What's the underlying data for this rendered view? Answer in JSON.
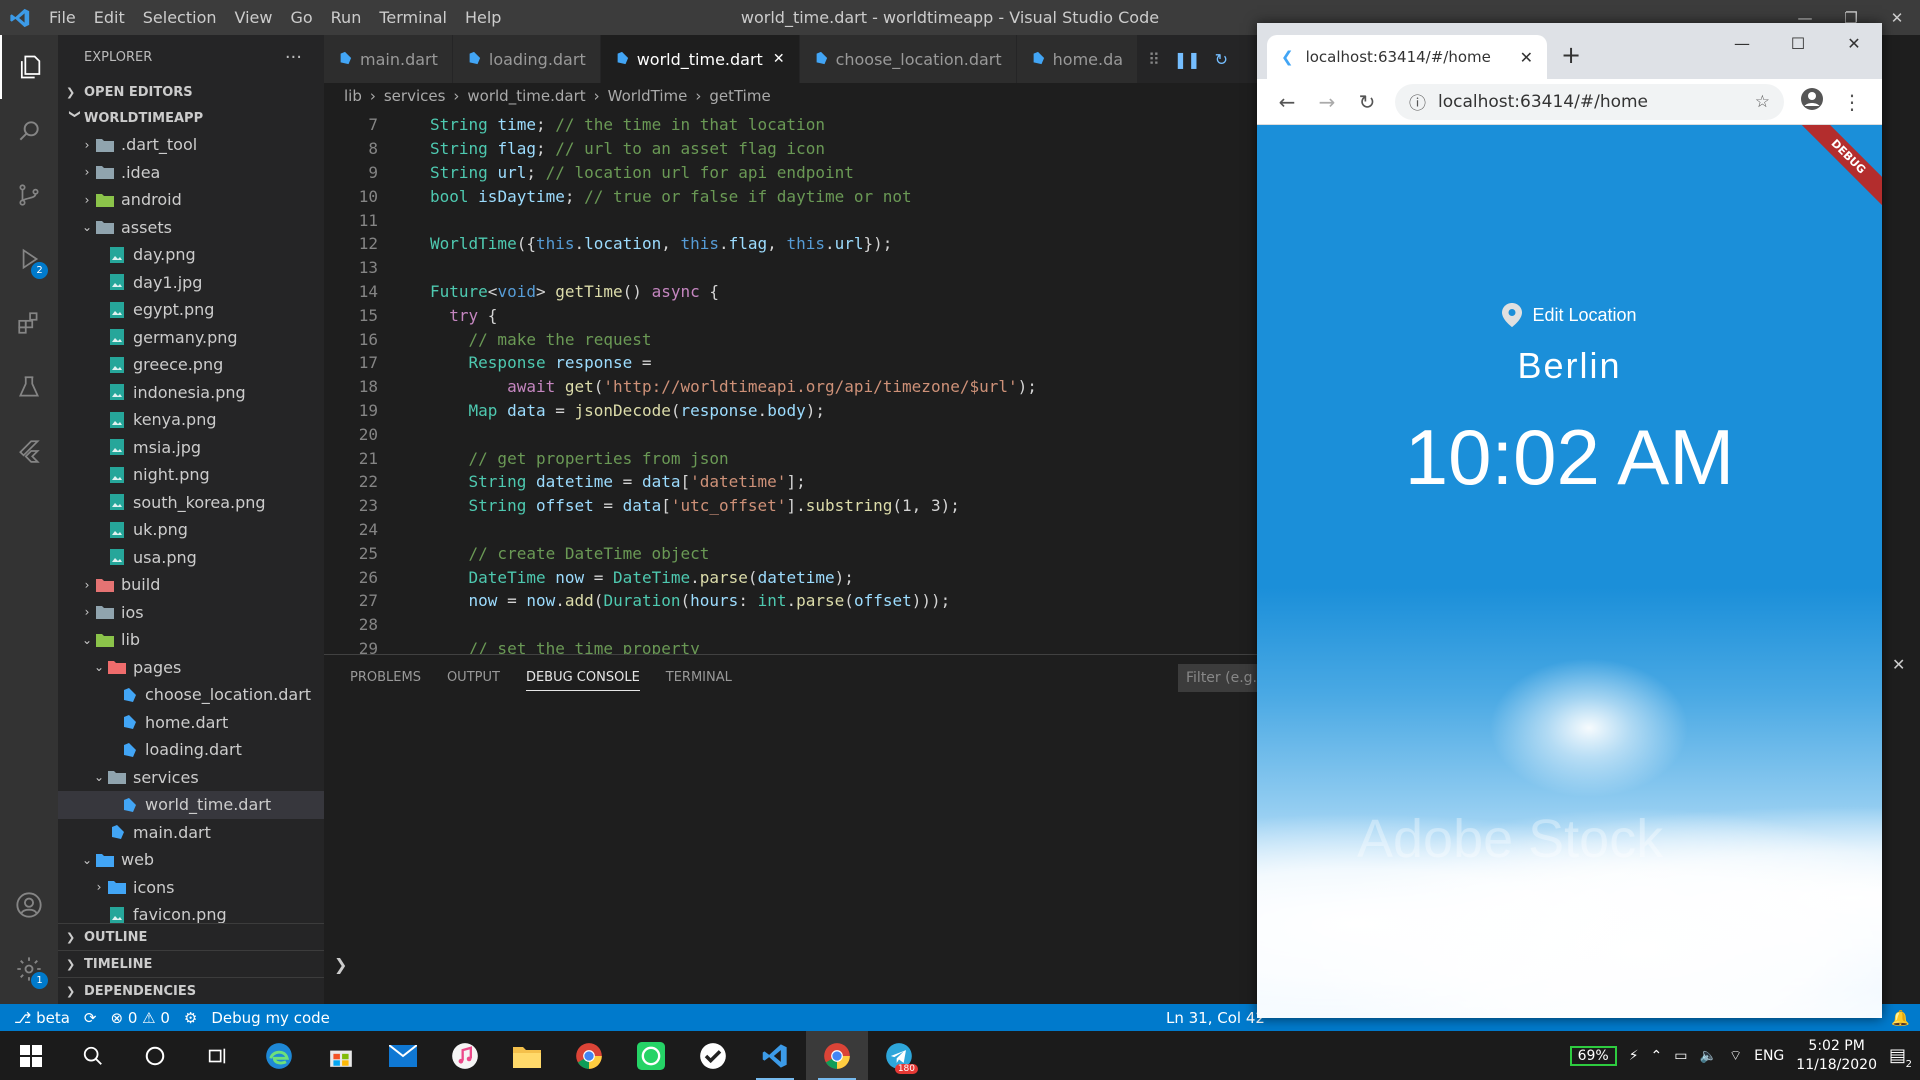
{
  "titlebar": {
    "menu": [
      "File",
      "Edit",
      "Selection",
      "View",
      "Go",
      "Run",
      "Terminal",
      "Help"
    ],
    "title": "world_time.dart - worldtimeapp - Visual Studio Code"
  },
  "activity": {
    "debug_badge": "2",
    "settings_badge": "1"
  },
  "sidebar": {
    "header": "EXPLORER",
    "more": "···",
    "open_editors": "OPEN EDITORS",
    "project": "WORLDTIMEAPP",
    "tree": [
      {
        "label": ".dart_tool",
        "depth": 1,
        "kind": "folder",
        "state": "closed"
      },
      {
        "label": ".idea",
        "depth": 1,
        "kind": "folder",
        "state": "closed"
      },
      {
        "label": "android",
        "depth": 1,
        "kind": "folder",
        "state": "closed"
      },
      {
        "label": "assets",
        "depth": 1,
        "kind": "folder",
        "state": "open"
      },
      {
        "label": "day.png",
        "depth": 2,
        "kind": "image"
      },
      {
        "label": "day1.jpg",
        "depth": 2,
        "kind": "image"
      },
      {
        "label": "egypt.png",
        "depth": 2,
        "kind": "image"
      },
      {
        "label": "germany.png",
        "depth": 2,
        "kind": "image"
      },
      {
        "label": "greece.png",
        "depth": 2,
        "kind": "image"
      },
      {
        "label": "indonesia.png",
        "depth": 2,
        "kind": "image"
      },
      {
        "label": "kenya.png",
        "depth": 2,
        "kind": "image"
      },
      {
        "label": "msia.jpg",
        "depth": 2,
        "kind": "image"
      },
      {
        "label": "night.png",
        "depth": 2,
        "kind": "image"
      },
      {
        "label": "south_korea.png",
        "depth": 2,
        "kind": "image"
      },
      {
        "label": "uk.png",
        "depth": 2,
        "kind": "image"
      },
      {
        "label": "usa.png",
        "depth": 2,
        "kind": "image"
      },
      {
        "label": "build",
        "depth": 1,
        "kind": "folder",
        "state": "closed"
      },
      {
        "label": "ios",
        "depth": 1,
        "kind": "folder",
        "state": "closed"
      },
      {
        "label": "lib",
        "depth": 1,
        "kind": "folder",
        "state": "open"
      },
      {
        "label": "pages",
        "depth": 2,
        "kind": "folder",
        "state": "open"
      },
      {
        "label": "choose_location.dart",
        "depth": 3,
        "kind": "dart"
      },
      {
        "label": "home.dart",
        "depth": 3,
        "kind": "dart"
      },
      {
        "label": "loading.dart",
        "depth": 3,
        "kind": "dart"
      },
      {
        "label": "services",
        "depth": 2,
        "kind": "folder",
        "state": "open"
      },
      {
        "label": "world_time.dart",
        "depth": 3,
        "kind": "dart",
        "selected": true
      },
      {
        "label": "main.dart",
        "depth": 2,
        "kind": "dart"
      },
      {
        "label": "web",
        "depth": 1,
        "kind": "folder",
        "state": "open"
      },
      {
        "label": "icons",
        "depth": 2,
        "kind": "folder",
        "state": "closed"
      },
      {
        "label": "favicon.png",
        "depth": 2,
        "kind": "image"
      }
    ],
    "outline": "OUTLINE",
    "timeline": "TIMELINE",
    "dependencies": "DEPENDENCIES"
  },
  "tabs": [
    {
      "label": "main.dart",
      "active": false
    },
    {
      "label": "loading.dart",
      "active": false
    },
    {
      "label": "world_time.dart",
      "active": true
    },
    {
      "label": "choose_location.dart",
      "active": false
    },
    {
      "label": "home.da",
      "active": false
    }
  ],
  "breadcrumb": {
    "parts": [
      "lib",
      "services",
      "world_time.dart",
      "WorldTime",
      "getTime"
    ]
  },
  "code_lines": [
    {
      "n": "7",
      "html": "<span class='t'>String</span><span class='pl'> </span><span class='v'>time</span><span class='pl'>; </span><span class='c'>// the time in that location</span>"
    },
    {
      "n": "8",
      "html": "<span class='t'>String</span><span class='pl'> </span><span class='v'>flag</span><span class='pl'>; </span><span class='c'>// url to an asset flag icon</span>"
    },
    {
      "n": "9",
      "html": "<span class='t'>String</span><span class='pl'> </span><span class='v'>url</span><span class='pl'>; </span><span class='c'>// location url for api endpoint</span>"
    },
    {
      "n": "10",
      "html": "<span class='t'>bool</span><span class='pl'> </span><span class='v'>isDaytime</span><span class='pl'>; </span><span class='c'>// true or false if daytime or not</span>"
    },
    {
      "n": "11",
      "html": ""
    },
    {
      "n": "12",
      "html": "<span class='t'>WorldTime</span><span class='pl'>({</span><span class='k'>this</span><span class='pl'>.</span><span class='v'>location</span><span class='pl'>, </span><span class='k'>this</span><span class='pl'>.</span><span class='v'>flag</span><span class='pl'>, </span><span class='k'>this</span><span class='pl'>.</span><span class='v'>url</span><span class='pl'>});</span>"
    },
    {
      "n": "13",
      "html": ""
    },
    {
      "n": "14",
      "html": "<span class='t'>Future</span><span class='pl'>&lt;</span><span class='k'>void</span><span class='pl'>&gt; </span><span class='f'>getTime</span><span class='pl'>() </span><span class='ctl'>async</span><span class='pl'> {</span>"
    },
    {
      "n": "15",
      "html": "  <span class='ctl'>try</span><span class='pl'> {</span>"
    },
    {
      "n": "16",
      "html": "    <span class='c'>// make the request</span>"
    },
    {
      "n": "17",
      "html": "    <span class='t'>Response</span><span class='pl'> </span><span class='v'>response</span><span class='pl'> =</span>"
    },
    {
      "n": "18",
      "html": "        <span class='ctl'>await</span><span class='pl'> </span><span class='f'>get</span><span class='pl'>(</span><span class='s'>'http://worldtimeapi.org/api/timezone/$url'</span><span class='pl'>);</span>"
    },
    {
      "n": "19",
      "html": "    <span class='t'>Map</span><span class='pl'> </span><span class='v'>data</span><span class='pl'> = </span><span class='f'>jsonDecode</span><span class='pl'>(</span><span class='v'>response</span><span class='pl'>.</span><span class='v'>body</span><span class='pl'>);</span>"
    },
    {
      "n": "20",
      "html": ""
    },
    {
      "n": "21",
      "html": "    <span class='c'>// get properties from json</span>"
    },
    {
      "n": "22",
      "html": "    <span class='t'>String</span><span class='pl'> </span><span class='v'>datetime</span><span class='pl'> = </span><span class='v'>data</span><span class='pl'>[</span><span class='s'>'datetime'</span><span class='pl'>];</span>"
    },
    {
      "n": "23",
      "html": "    <span class='t'>String</span><span class='pl'> </span><span class='v'>offset</span><span class='pl'> = </span><span class='v'>data</span><span class='pl'>[</span><span class='s'>'utc_offset'</span><span class='pl'>].</span><span class='f'>substring</span><span class='pl'>(1, 3);</span>"
    },
    {
      "n": "24",
      "html": ""
    },
    {
      "n": "25",
      "html": "    <span class='c'>// create DateTime object</span>"
    },
    {
      "n": "26",
      "html": "    <span class='t'>DateTime</span><span class='pl'> </span><span class='v'>now</span><span class='pl'> = </span><span class='t'>DateTime</span><span class='pl'>.</span><span class='f'>parse</span><span class='pl'>(</span><span class='v'>datetime</span><span class='pl'>);</span>"
    },
    {
      "n": "27",
      "html": "    <span class='v'>now</span><span class='pl'> = </span><span class='v'>now</span><span class='pl'>.</span><span class='f'>add</span><span class='pl'>(</span><span class='t'>Duration</span><span class='pl'>(</span><span class='v'>hours</span><span class='pl'>: </span><span class='t'>int</span><span class='pl'>.</span><span class='f'>parse</span><span class='pl'>(</span><span class='v'>offset</span><span class='pl'>)));</span>"
    },
    {
      "n": "28",
      "html": ""
    },
    {
      "n": "29",
      "html": "    <span class='c'>// set the time property</span>"
    }
  ],
  "panel": {
    "tabs": [
      "PROBLEMS",
      "OUTPUT",
      "DEBUG CONSOLE",
      "TERMINAL"
    ],
    "active": "DEBUG CONSOLE",
    "filter_placeholder": "Filter (e.g. t"
  },
  "statusbar": {
    "branch": "beta",
    "errors": "0",
    "warnings": "0",
    "debug": "Debug my code",
    "position": "Ln 31, Col 42"
  },
  "browser": {
    "tab_title": "localhost:63414/#/home",
    "url": "localhost:63414/#/home"
  },
  "app": {
    "edit_location": "Edit Location",
    "city": "Berlin",
    "time": "10:02 AM",
    "debug_banner": "DEBUG",
    "watermark": "Adobe Stock",
    "bg_color": "#1b8fd9"
  },
  "taskbar": {
    "battery": "69%",
    "lang": "ENG",
    "clock_time": "5:02 PM",
    "clock_date": "11/18/2020",
    "notif_count": "2",
    "telegram_badge": "180"
  }
}
